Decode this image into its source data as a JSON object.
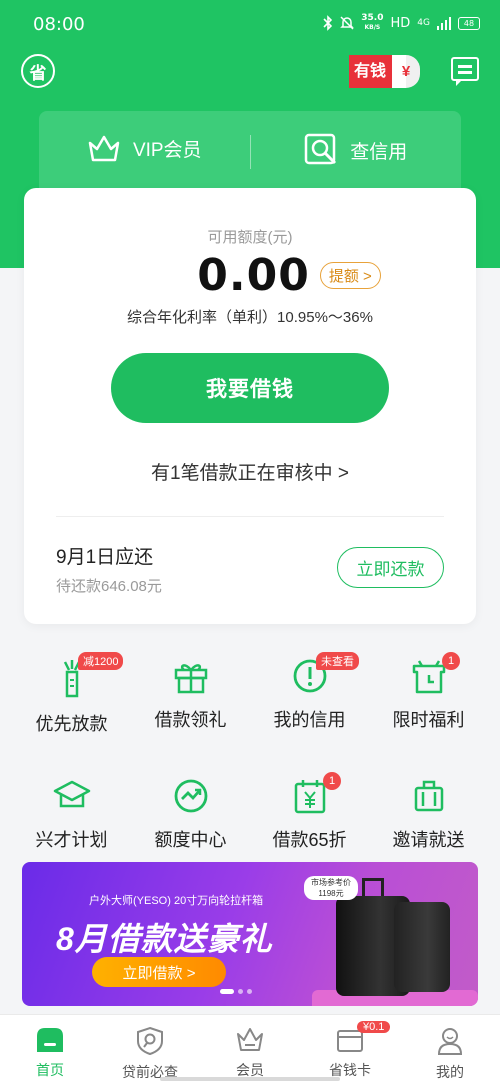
{
  "status_bar": {
    "time": "08:00",
    "speed": "35.0",
    "speed_unit": "KB/S",
    "hd": "HD",
    "network": "4G",
    "battery": "48"
  },
  "header": {
    "logo": "省",
    "rich_badge": "有钱",
    "rich_coin": "¥"
  },
  "vip_strip": {
    "vip_label": "VIP会员",
    "credit_label": "查信用"
  },
  "card": {
    "limit_label": "可用额度(元)",
    "amount": "0.00",
    "raise_button": "提额 >",
    "rate_text": "综合年化利率（单利）10.95%～36%",
    "borrow_button": "我要借钱",
    "review_text": "有1笔借款正在审核中 >",
    "due_title": "9月1日应还",
    "due_amount": "待还款646.08元",
    "repay_button": "立即还款"
  },
  "grid": [
    {
      "label": "优先放款",
      "icon": "speed-icon",
      "tag": "减1200"
    },
    {
      "label": "借款领礼",
      "icon": "gift-icon"
    },
    {
      "label": "我的信用",
      "icon": "alert-icon",
      "tag": "未查看"
    },
    {
      "label": "限时福利",
      "icon": "clock-gift-icon",
      "badge": "1"
    },
    {
      "label": "兴才计划",
      "icon": "graduation-cap-icon"
    },
    {
      "label": "额度中心",
      "icon": "trend-icon"
    },
    {
      "label": "借款65折",
      "icon": "yuan-calendar-icon",
      "badge": "1"
    },
    {
      "label": "邀请就送",
      "icon": "luggage-icon"
    }
  ],
  "banner": {
    "subtitle": "户外大师(YESO) 20寸万向轮拉杆箱",
    "title": "8月借款送豪礼",
    "cta": "立即借款 >",
    "price_tag_line1": "市场参考价",
    "price_tag_line2": "1198元"
  },
  "tabbar": [
    {
      "label": "首页",
      "icon": "home-icon",
      "active": true
    },
    {
      "label": "贷前必查",
      "icon": "shield-search-icon"
    },
    {
      "label": "会员",
      "icon": "crown-icon"
    },
    {
      "label": "省钱卡",
      "icon": "card-icon",
      "badge": "¥0.1"
    },
    {
      "label": "我的",
      "icon": "user-icon"
    }
  ],
  "colors": {
    "brand_green": "#1fc463",
    "accent_orange": "#d98b17",
    "badge_red": "#f04a4a"
  }
}
